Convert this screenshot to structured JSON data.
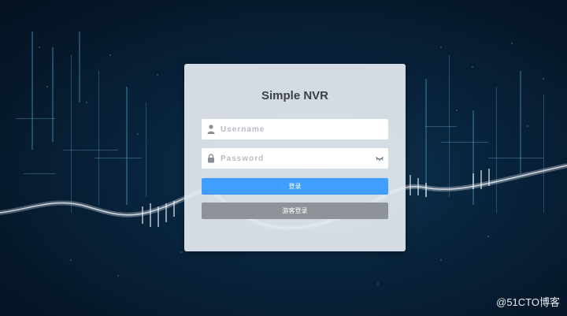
{
  "login": {
    "title": "Simple NVR",
    "username_placeholder": "Username",
    "password_placeholder": "Password",
    "login_label": "登录",
    "guest_label": "游客登录"
  },
  "icons": {
    "user": "user-icon",
    "lock": "lock-icon",
    "eye": "eye-closed-icon"
  },
  "colors": {
    "primary": "#409eff",
    "secondary": "#8e9299",
    "card": "#e4e9f0"
  },
  "watermark": "@51CTO博客"
}
